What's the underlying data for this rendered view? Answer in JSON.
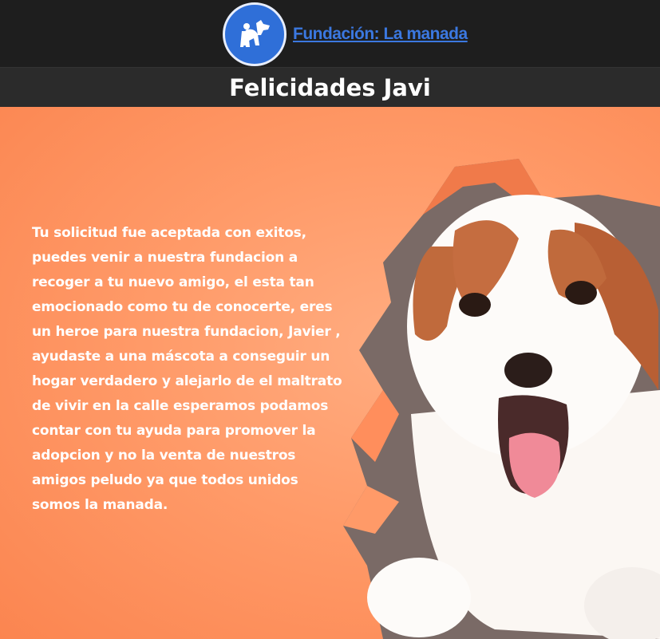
{
  "header": {
    "logo_text": "Fundación: La manada",
    "logo_icon": "dog-person-icon"
  },
  "page": {
    "title": "Felicidades Javi"
  },
  "content": {
    "message": "Tu solicitud fue aceptada con exitos, puedes venir a nuestra fundacion a recoger a tu nuevo amigo, el esta tan emocionado como tu de conocerte, eres un heroe para nuestra fundacion, Javier , ayudaste a una máscota a conseguir un hogar verdadero y alejarlo de el maltrato de vivir en la calle esperamos podamos contar con tu ayuda para promover la adopcion y no la venta de nuestros amigos peludo ya que todos unidos somos la manada."
  },
  "colors": {
    "header_bg": "#1e1e1e",
    "title_bar_bg": "#2b2b2b",
    "hero_bg": "#ff9a68",
    "brand_blue": "#2f6fd8"
  }
}
